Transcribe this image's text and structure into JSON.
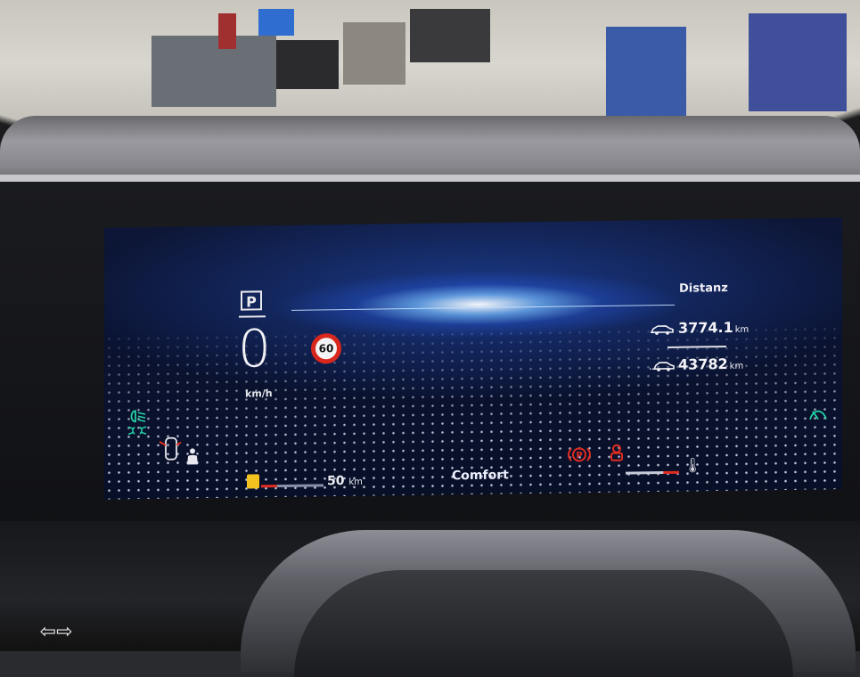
{
  "cluster": {
    "gear": "P",
    "speed": "0",
    "speed_unit": "km/h",
    "speed_limit": "60",
    "distance_title": "Distanz",
    "trip_value": "3774.1",
    "trip_unit": "km",
    "odometer_value": "43782",
    "odometer_unit": "km",
    "range_value": "50",
    "range_unit": "km",
    "drive_mode": "Comfort"
  },
  "colors": {
    "screen_bg": "#0a1230",
    "accent_glow": "#2f6bff",
    "warning_red": "#e02c21",
    "indicator_green": "#22d3a6",
    "fuel_yellow": "#f4c21f"
  },
  "icons": [
    "low-beam-icon",
    "parking-light-icon",
    "door-open-icon",
    "seatbelt-icon",
    "parking-brake-icon",
    "brake-warning-icon",
    "coolant-temp-icon",
    "washer-fluid-icon",
    "fuel-pump-icon",
    "hazard-icon"
  ]
}
